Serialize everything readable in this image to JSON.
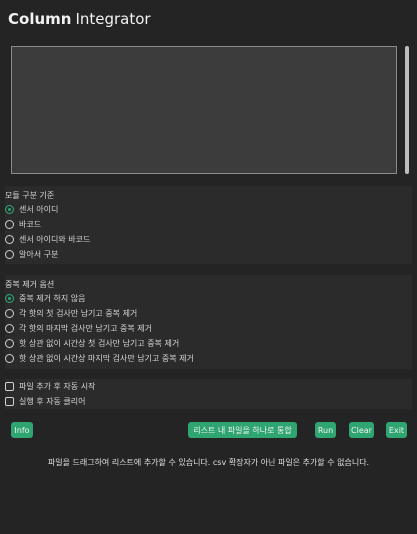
{
  "app": {
    "title_bold": "Column",
    "title_light": "Integrator"
  },
  "file_list": {
    "items": []
  },
  "module_group": {
    "label": "모듈 구분 기준",
    "options": [
      "센서 아이디",
      "바코드",
      "센서 아이디와 바코드",
      "알아서 구분"
    ],
    "selected": 0
  },
  "dedup_group": {
    "label": "중복 제거 옵션",
    "options": [
      "중복 제거 하지 않음",
      "각 핫의 첫 검사만 남기고 중복 제거",
      "각 핫의 마지막 검사만 남기고 중복 제거",
      "핫 상관 없이 시간상 첫 검사만 남기고 중복 제거",
      "핫 상관 없이 시간상 마지막 검사만 남기고 중복 제거"
    ],
    "selected": 0
  },
  "checkboxes": {
    "auto_start": "파일 추가 후 자동 시작",
    "auto_clear": "실행 후 자동 클리어"
  },
  "buttons": {
    "info": "Info",
    "merge": "리스트 내 파일을 하나로 통합",
    "run": "Run",
    "clear": "Clear",
    "exit": "Exit"
  },
  "status": "파일을 드래그하여 리스트에 추가할 수 있습니다. csv 확장자가 아닌 파일은 추가할 수 없습니다.",
  "colors": {
    "accent": "#2fa572",
    "background": "#242424",
    "panel": "#2b2b2b"
  }
}
